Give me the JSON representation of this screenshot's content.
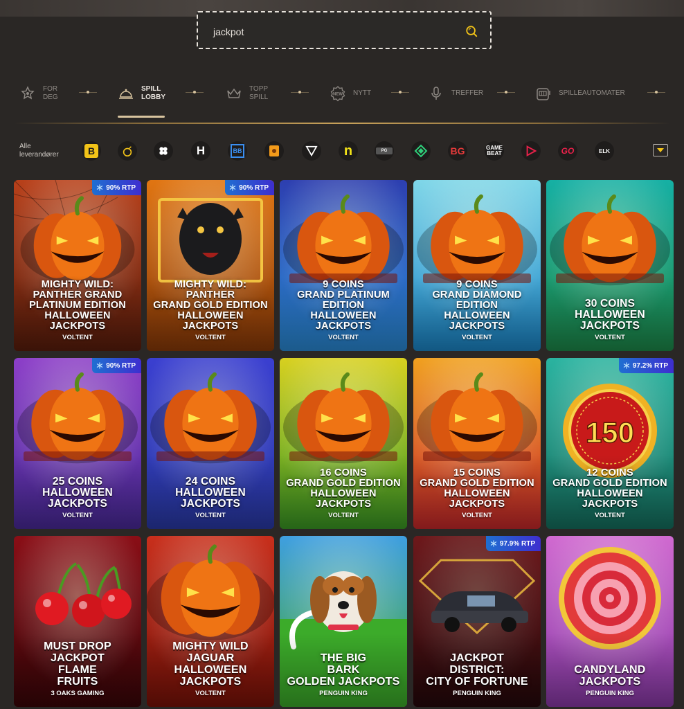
{
  "search": {
    "value": "jackpot"
  },
  "nav": {
    "items": [
      {
        "label": "FOR\nDEG",
        "icon": "star-badge-icon",
        "active": false
      },
      {
        "label": "SPILL\nLOBBY",
        "icon": "service-bell-icon",
        "active": true
      },
      {
        "label": "TOPP\nSPILL",
        "icon": "crown-icon",
        "active": false
      },
      {
        "label": "NYTT",
        "icon": "new-badge-icon",
        "active": false
      },
      {
        "label": "TREFFER",
        "icon": "microphone-icon",
        "active": false
      },
      {
        "label": "SPILLEAUTOMATER",
        "icon": "slot-machine-icon",
        "active": false
      }
    ]
  },
  "providers": {
    "label": "Alle\nleverandører",
    "logos": [
      {
        "name": "B",
        "bg": "#1e1c1b",
        "color": "#f2c318"
      },
      {
        "name": "bomb",
        "bg": "#1e1c1b",
        "color": "#f2c318"
      },
      {
        "name": "clover",
        "bg": "#1e1c1b",
        "color": "#ffffff"
      },
      {
        "name": "H",
        "bg": "#1e1c1b",
        "color": "#ffffff"
      },
      {
        "name": "BB",
        "bg": "#1e1c1b",
        "color": "#3a8ef0"
      },
      {
        "name": "shield",
        "bg": "#1e1c1b",
        "color": "#f29a1a"
      },
      {
        "name": "V",
        "bg": "#1e1c1b",
        "color": "#ffffff"
      },
      {
        "name": "n",
        "bg": "#1e1c1b",
        "color": "#f2e218"
      },
      {
        "name": "PG",
        "bg": "#1e1c1b",
        "color": "#bbbbbb"
      },
      {
        "name": "diamond",
        "bg": "#1e1c1b",
        "color": "#2fcf7a"
      },
      {
        "name": "BG",
        "bg": "#1e1c1b",
        "color": "#e43a3a"
      },
      {
        "name": "GAME\nBEAT",
        "bg": "#1e1c1b",
        "color": "#ffffff"
      },
      {
        "name": "play",
        "bg": "#1e1c1b",
        "color": "#e8214a"
      },
      {
        "name": "GO",
        "bg": "#1e1c1b",
        "color": "#e8214a"
      },
      {
        "name": "ELK",
        "bg": "#1e1c1b",
        "color": "#ffffff"
      }
    ]
  },
  "games": [
    {
      "title": "MIGHTY WILD:\nPANTHER GRAND\nPLATINUM EDITION\nHALLOWEEN\nJACKPOTS",
      "provider": "VOLTENT",
      "rtp": "90% RTP",
      "bg1": "#b8401a",
      "bg2": "#5a1d0c",
      "art": "pumpkin-web"
    },
    {
      "title": "MIGHTY WILD:\nPANTHER\nGRAND GOLD EDITION\nHALLOWEEN\nJACKPOTS",
      "provider": "VOLTENT",
      "rtp": "90% RTP",
      "bg1": "#e07512",
      "bg2": "#8a3a08",
      "art": "panther"
    },
    {
      "title": "9 COINS\nGRAND PLATINUM\nEDITION\nHALLOWEEN\nJACKPOTS",
      "provider": "VOLTENT",
      "rtp": "",
      "bg1": "#2d3fb0",
      "bg2": "#2a8bd6",
      "art": "pumpkin"
    },
    {
      "title": "9 COINS\nGRAND DIAMOND\nEDITION\nHALLOWEEN\nJACKPOTS",
      "provider": "VOLTENT",
      "rtp": "",
      "bg1": "#7fd6e8",
      "bg2": "#1b86c8",
      "art": "pumpkin"
    },
    {
      "title": "30 COINS\nHALLOWEEN\nJACKPOTS",
      "provider": "VOLTENT",
      "rtp": "",
      "bg1": "#16b0a4",
      "bg2": "#1d8a4a",
      "art": "pumpkin"
    },
    {
      "title": "25 COINS\nHALLOWEEN\nJACKPOTS",
      "provider": "VOLTENT",
      "rtp": "90% RTP",
      "bg1": "#8c3fc8",
      "bg2": "#4a2a9a",
      "art": "pumpkin"
    },
    {
      "title": "24 COINS\nHALLOWEEN\nJACKPOTS",
      "provider": "VOLTENT",
      "rtp": "",
      "bg1": "#3a3fd0",
      "bg2": "#2a3aa8",
      "art": "pumpkin"
    },
    {
      "title": "16 COINS\nGRAND GOLD EDITION\nHALLOWEEN\nJACKPOTS",
      "provider": "VOLTENT",
      "rtp": "",
      "bg1": "#d7d020",
      "bg2": "#3a9a24",
      "art": "pumpkin"
    },
    {
      "title": "15 COINS\nGRAND GOLD EDITION\nHALLOWEEN\nJACKPOTS",
      "provider": "VOLTENT",
      "rtp": "",
      "bg1": "#f0a020",
      "bg2": "#c8282a",
      "art": "pumpkin"
    },
    {
      "title": "12 COINS\nGRAND GOLD EDITION\nHALLOWEEN\nJACKPOTS",
      "provider": "VOLTENT",
      "rtp": "97.2% RTP",
      "bg1": "#2ab3a0",
      "bg2": "#15705f",
      "art": "coin150",
      "coin_value": "150"
    },
    {
      "title": "MUST DROP\nJACKPOT\nFLAME\nFRUITS",
      "provider": "3 OAKS GAMING",
      "rtp": "",
      "bg1": "#8a0e16",
      "bg2": "#3a0508",
      "art": "cherries"
    },
    {
      "title": "MIGHTY WILD\nJAGUAR\nHALLOWEEN\nJACKPOTS",
      "provider": "VOLTENT",
      "rtp": "",
      "bg1": "#c82f1c",
      "bg2": "#7a1208",
      "art": "pumpkin-big"
    },
    {
      "title": "THE BIG\nBARK\nGOLDEN JACKPOTS",
      "provider": "PENGUIN KING",
      "rtp": "",
      "bg1": "#3f9fe0",
      "bg2": "#3ca52a",
      "art": "dog"
    },
    {
      "title": "JACKPOT\nDISTRICT:\nCITY OF FORTUNE",
      "provider": "PENGUIN KING",
      "rtp": "97.9% RTP",
      "bg1": "#a8262a",
      "bg2": "#3a0c10",
      "art": "car"
    },
    {
      "title": "CANDYLAND\nJACKPOTS",
      "provider": "PENGUIN KING",
      "rtp": "",
      "bg1": "#d06ad0",
      "bg2": "#8a3aa8",
      "art": "lollipop"
    }
  ]
}
